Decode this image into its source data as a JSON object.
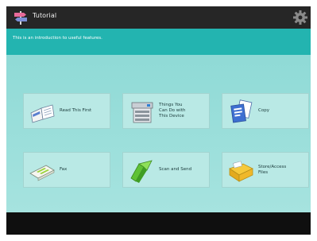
{
  "window": {
    "title": "Tutorial"
  },
  "banner": {
    "text": "This is an introduction to useful features."
  },
  "tiles": [
    {
      "label": "Read This First",
      "icon": "book-icon"
    },
    {
      "label": "Things You\nCan Do with\nThis Device",
      "icon": "printer-icon"
    },
    {
      "label": "Copy",
      "icon": "copy-icon"
    },
    {
      "label": "Fax",
      "icon": "fax-icon"
    },
    {
      "label": "Scan and Send",
      "icon": "scan-send-icon"
    },
    {
      "label": "Store/Access\nFiles",
      "icon": "folder-icon"
    }
  ],
  "colors": {
    "title_bar": "#262626",
    "banner": "#23b4b0",
    "content_bg": "#9adfdb",
    "tile_bg": "#b9e9e5",
    "footer": "#0f0f0f"
  }
}
